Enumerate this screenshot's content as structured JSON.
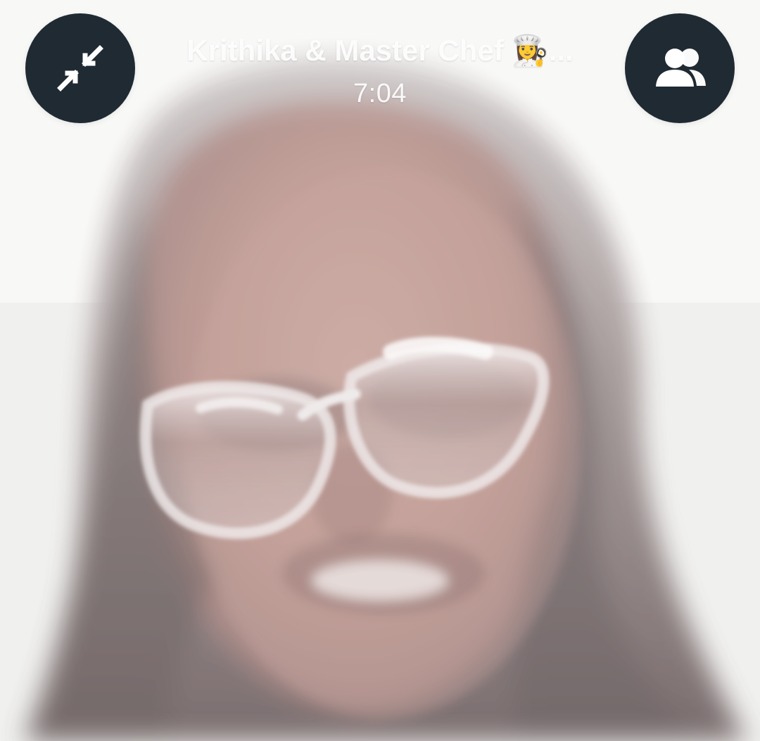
{
  "call": {
    "title": "Krithika & Master Chef 👩‍🍳...",
    "timer": "7:04"
  },
  "controls": {
    "minimize_icon": "minimize-icon",
    "participants_icon": "participants-icon"
  },
  "colors": {
    "button_background": "#1f2a33",
    "text": "#ffffff",
    "video_background": "#ebe8e8"
  }
}
